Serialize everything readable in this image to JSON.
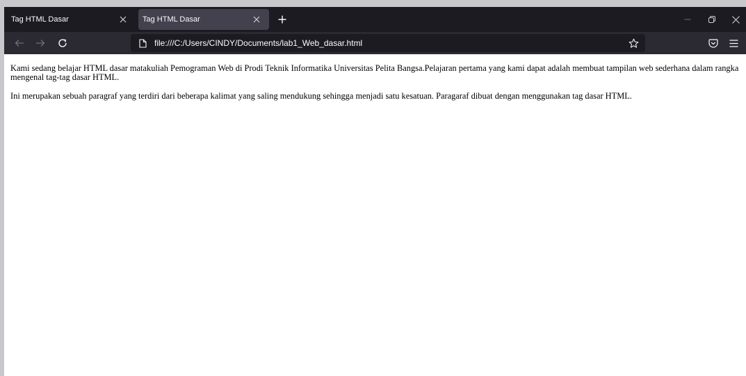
{
  "browser": {
    "tabs": [
      {
        "title": "Tag HTML Dasar",
        "active": false
      },
      {
        "title": "Tag HTML Dasar",
        "active": true
      }
    ],
    "url": "file:///C:/Users/CINDY/Documents/lab1_Web_dasar.html",
    "icons": {
      "tab_close": "close-icon",
      "new_tab": "plus-icon",
      "back": "arrow-left-icon",
      "forward": "arrow-right-icon",
      "reload": "reload-icon",
      "page": "document-icon",
      "bookmark": "star-icon",
      "pocket": "pocket-icon",
      "menu": "hamburger-menu-icon",
      "minimize": "minimize-icon",
      "restore": "restore-icon",
      "close": "close-icon"
    },
    "colors": {
      "tabstrip": "#1c1b22",
      "active_tab": "#42414d",
      "toolbar": "#2b2a33",
      "urlbar": "#1c1b22",
      "text": "#fbfbfe"
    }
  },
  "page": {
    "paragraphs": [
      "Kami sedang belajar HTML dasar matakuliah Pemograman Web di Prodi Teknik Informatika Universitas Pelita Bangsa.Pelajaran pertama yang kami dapat adalah membuat tampilan web sederhana dalam rangka mengenal tag-tag dasar HTML.",
      "Ini merupakan sebuah paragraf yang terdiri dari beberapa kalimat yang saling mendukung sehingga menjadi satu kesatuan. Paragaraf dibuat dengan menggunakan tag dasar HTML."
    ]
  }
}
